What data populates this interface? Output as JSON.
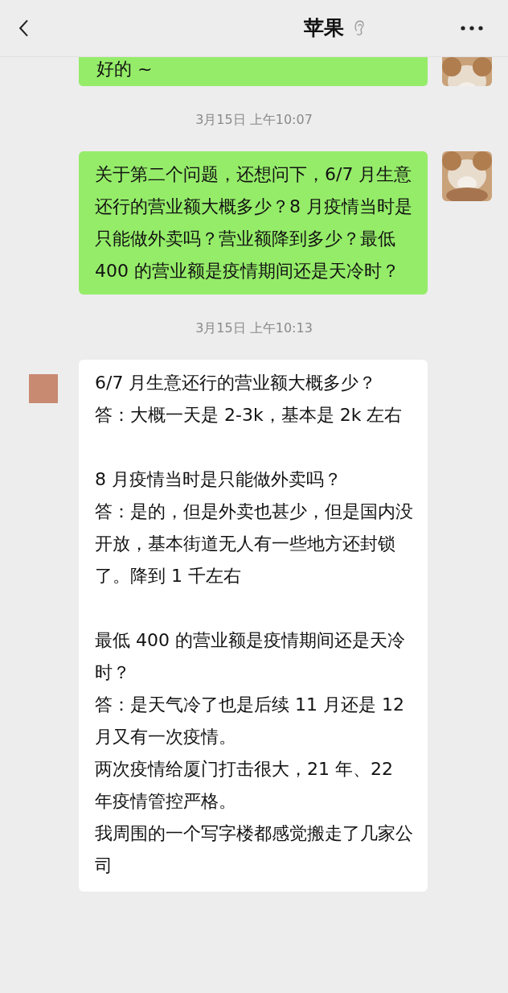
{
  "header": {
    "title": "苹果"
  },
  "messages": [
    {
      "kind": "outgoing",
      "text": "好的 ~"
    },
    {
      "kind": "time",
      "text": "3月15日 上午10:07"
    },
    {
      "kind": "outgoing",
      "text": "关于第二个问题，还想问下，6/7 月生意还行的营业额大概多少？8 月疫情当时是只能做外卖吗？营业额降到多少？最低 400 的营业额是疫情期间还是天冷时？"
    },
    {
      "kind": "time",
      "text": "3月15日 上午10:13"
    },
    {
      "kind": "incoming",
      "paragraphs": [
        {
          "lines": [
            "6/7 月生意还行的营业额大概多少？",
            "答：大概一天是 2-3k，基本是 2k 左右"
          ]
        },
        {
          "lines": [
            "8 月疫情当时是只能做外卖吗？",
            "答：是的，但是外卖也甚少，但是国内没开放，基本街道无人有一些地方还封锁了。降到 1 千左右"
          ]
        },
        {
          "lines": [
            "最低 400 的营业额是疫情期间还是天冷时？",
            "答：是天气冷了也是后续 11 月还是 12 月又有一次疫情。",
            "两次疫情给厦门打击很大，21 年、22 年疫情管控严格。",
            "我周围的一个写字楼都感觉搬走了几家公司"
          ]
        }
      ]
    }
  ]
}
